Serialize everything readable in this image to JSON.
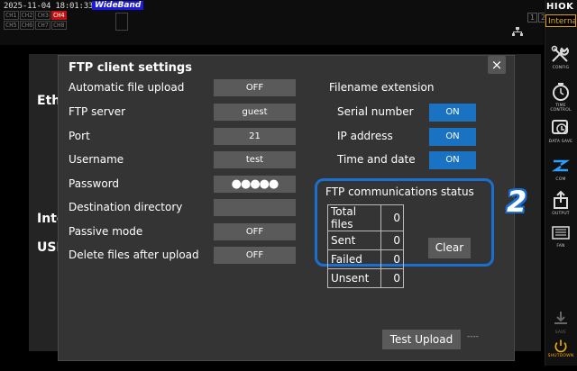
{
  "topbar": {
    "timestamp": "2025-11-04 18:01:33",
    "mode_badge": "WideBand",
    "channels_row1": [
      "CH1",
      "CH2",
      "CH3",
      "CH4"
    ],
    "channels_row2": [
      "CH5",
      "CH6",
      "CH7",
      "CH8"
    ],
    "pages": [
      "1",
      "2",
      "3",
      "4"
    ]
  },
  "brand": {
    "name": "HIOK",
    "sub": "Interna"
  },
  "background": {
    "eth": "Eth",
    "int": "Inte",
    "usb": "USI",
    "f": "F"
  },
  "dialog": {
    "title": "FTP client settings",
    "close": "×",
    "rows": [
      {
        "label": "Automatic file upload",
        "value": "OFF"
      },
      {
        "label": "FTP server",
        "value": "guest"
      },
      {
        "label": "Port",
        "value": "21"
      },
      {
        "label": "Username",
        "value": "test"
      },
      {
        "label": "Password",
        "value": "●●●●●"
      },
      {
        "label": "Destination directory",
        "value": ""
      },
      {
        "label": "Passive mode",
        "value": "OFF"
      },
      {
        "label": "Delete files after upload",
        "value": "OFF"
      }
    ],
    "ext_title": "Filename extension",
    "ext": [
      {
        "label": "Serial number",
        "value": "ON"
      },
      {
        "label": "IP address",
        "value": "ON"
      },
      {
        "label": "Time and date",
        "value": "ON"
      }
    ],
    "status_title": "FTP communications status",
    "status": [
      {
        "label": "Total files",
        "value": "0"
      },
      {
        "label": "Sent",
        "value": "0"
      },
      {
        "label": "Failed",
        "value": "0"
      },
      {
        "label": "Unsent",
        "value": "0"
      }
    ],
    "clear": "Clear",
    "test_upload": "Test Upload",
    "test_result": "----"
  },
  "callout": "2",
  "sidebar": [
    {
      "label": "CONFIG"
    },
    {
      "label": "TIME CONTROL"
    },
    {
      "label": "DATA SAVE"
    },
    {
      "label": "COM"
    },
    {
      "label": "OUTPUT"
    },
    {
      "label": "FAN"
    },
    {
      "label": "SAVE"
    },
    {
      "label": "SHUTDOWN"
    }
  ]
}
